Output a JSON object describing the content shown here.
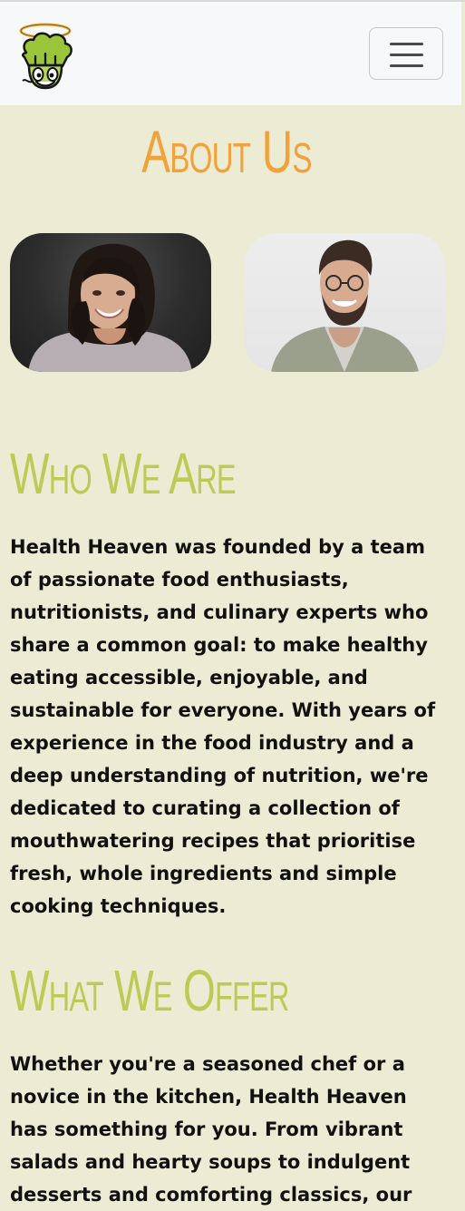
{
  "navbar": {
    "logo_name": "chef-halo-logo",
    "toggle_label": "Toggle navigation"
  },
  "page": {
    "title": "About Us"
  },
  "team": [
    {
      "name": "team-photo-woman"
    },
    {
      "name": "team-photo-man"
    }
  ],
  "sections": [
    {
      "heading": "Who We Are",
      "body": "Health Heaven was founded by a team of passionate food enthusiasts, nutritionists, and culinary experts who share a common goal: to make healthy eating accessible, enjoyable, and sustainable for everyone. With years of experience in the food industry and a deep understanding of nutrition, we're dedicated to curating a collection of mouthwatering recipes that prioritise fresh, whole ingredients and simple cooking techniques."
    },
    {
      "heading": "What We Offer",
      "body": "Whether you're a seasoned chef or a novice in the kitchen, Health Heaven has something for you. From vibrant salads and hearty soups to indulgent desserts and comforting classics, our"
    }
  ],
  "colors": {
    "page_background": "#ecebd4",
    "navbar_background": "#f7f8fa",
    "title_orange": "#f2a23b",
    "heading_green": "#bccb55",
    "text": "#111111"
  }
}
